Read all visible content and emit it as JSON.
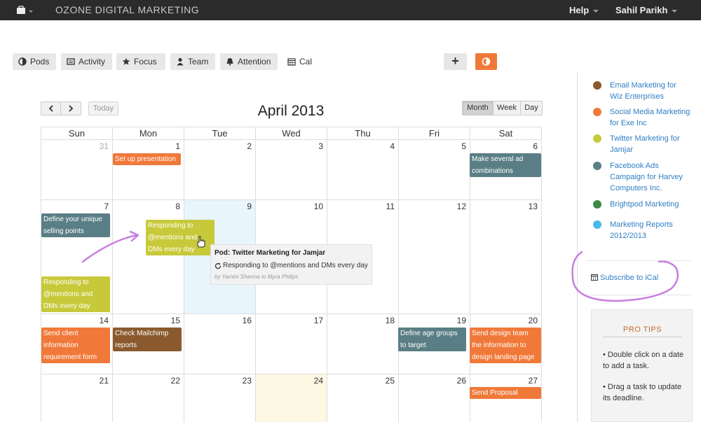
{
  "topbar": {
    "app_title": "OZONE DIGITAL MARKETING",
    "help_label": "Help",
    "user_name": "Sahil Parikh"
  },
  "tabs": [
    {
      "label": "Pods",
      "icon": "pod-icon"
    },
    {
      "label": "Activity",
      "icon": "list-icon"
    },
    {
      "label": "Focus",
      "icon": "star-icon"
    },
    {
      "label": "Team",
      "icon": "person-icon"
    },
    {
      "label": "Attention",
      "icon": "bell-icon"
    },
    {
      "label": "Cal",
      "icon": "calendar-icon"
    }
  ],
  "toolbar": {
    "plus_label": "+"
  },
  "calendar": {
    "today_label": "Today",
    "month_title": "April 2013",
    "views": [
      "Month",
      "Week",
      "Day"
    ],
    "active_view": "Month",
    "weekdays": [
      "Sun",
      "Mon",
      "Tue",
      "Wed",
      "Thu",
      "Fri",
      "Sat"
    ],
    "weeks": [
      [
        "31",
        "1",
        "2",
        "3",
        "4",
        "5",
        "6"
      ],
      [
        "7",
        "8",
        "9",
        "10",
        "11",
        "12",
        "13"
      ],
      [
        "14",
        "15",
        "16",
        "17",
        "18",
        "19",
        "20"
      ],
      [
        "21",
        "22",
        "23",
        "24",
        "25",
        "26",
        "27"
      ]
    ],
    "events": [
      {
        "title": "Set up presentation",
        "color": "#f0793a"
      },
      {
        "title": "Make several ad combinations",
        "color": "#5a7e85"
      },
      {
        "title": "Define your unique selling points",
        "color": "#5a7e85"
      },
      {
        "title": "Responding to @mentions and DMs every day",
        "color": "#c8c93a"
      },
      {
        "title": "Responding to @mentions and DMs every day",
        "color": "#c8c93a"
      },
      {
        "title": "Send client information requirement form",
        "color": "#f0793a"
      },
      {
        "title": "Check Mailchimp reports",
        "color": "#8a5a2e"
      },
      {
        "title": "Define age groups to target",
        "color": "#5a7e85"
      },
      {
        "title": "Send design team the information to design landing page",
        "color": "#f0793a"
      },
      {
        "title": "Send Proposal",
        "color": "#f0793a"
      }
    ]
  },
  "tooltip": {
    "title": "Pod: Twitter Marketing for Jamjar",
    "task": "Responding to @mentions and DMs every day",
    "by": "by Yamini Sharma to Myra Philips"
  },
  "sidebar": {
    "pods": [
      {
        "label": "Email Marketing for Wiz Enterprises",
        "color": "#8a5a2e"
      },
      {
        "label": "Social Media Marketing for Exe Inc",
        "color": "#f0793a"
      },
      {
        "label": "Twitter Marketing for Jamjar",
        "color": "#c8c93a"
      },
      {
        "label": "Facebook Ads Campaign for Harvey Computers Inc.",
        "color": "#5a7e85"
      },
      {
        "label": "Brightpod Marketing",
        "color": "#3d8a45"
      },
      {
        "label": "Marketing Reports 2012/2013",
        "color": "#4ab8ea"
      }
    ],
    "subscribe_label": "Subscribe to iCal",
    "tips_title": "PRO TIPS",
    "tips": [
      "• Double click on a date to add a task.",
      "• Drag a task to update its deadline."
    ]
  },
  "colors": {
    "topbar_bg": "#2b2b2b",
    "accent_orange": "#f0793a",
    "link_blue": "#2f7ec4",
    "annotation_purple": "#c77ee0"
  }
}
